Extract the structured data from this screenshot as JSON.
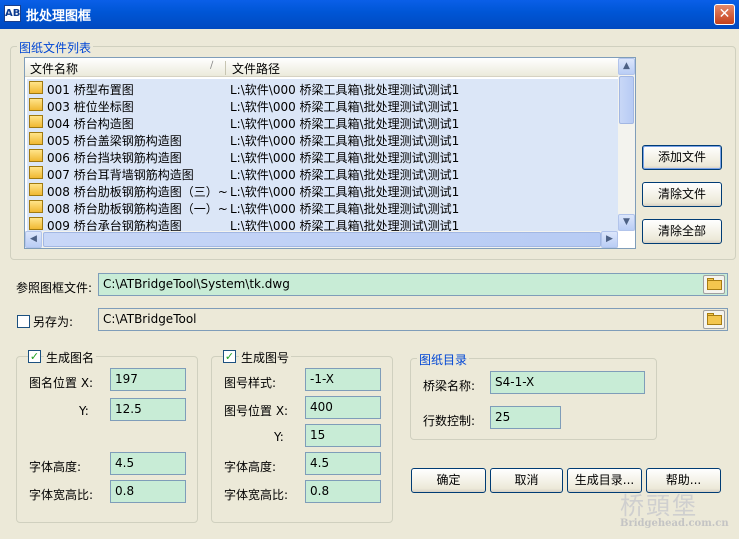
{
  "window": {
    "title": "批处理图框",
    "close_glyph": "✕",
    "icon_text": "AB"
  },
  "file_list": {
    "group_title": "图纸文件列表",
    "columns": {
      "name": "文件名称",
      "sort_glyph": "∕",
      "path": "文件路径"
    },
    "rows": [
      {
        "name": "001 桥型布置图",
        "path": "L:\\软件\\000 桥梁工具箱\\批处理测试\\测试1"
      },
      {
        "name": "003 桩位坐标图",
        "path": "L:\\软件\\000 桥梁工具箱\\批处理测试\\测试1"
      },
      {
        "name": "004 桥台构造图",
        "path": "L:\\软件\\000 桥梁工具箱\\批处理测试\\测试1"
      },
      {
        "name": "005 桥台盖梁钢筋构造图",
        "path": "L:\\软件\\000 桥梁工具箱\\批处理测试\\测试1"
      },
      {
        "name": "006 桥台挡块钢筋构造图",
        "path": "L:\\软件\\000 桥梁工具箱\\批处理测试\\测试1"
      },
      {
        "name": "007 桥台耳背墙钢筋构造图",
        "path": "L:\\软件\\000 桥梁工具箱\\批处理测试\\测试1"
      },
      {
        "name": "008 桥台肋板钢筋构造图（三）~",
        "path": "L:\\软件\\000 桥梁工具箱\\批处理测试\\测试1"
      },
      {
        "name": "008 桥台肋板钢筋构造图（一）~",
        "path": "L:\\软件\\000 桥梁工具箱\\批处理测试\\测试1"
      },
      {
        "name": "009 桥台承台钢筋构造图",
        "path": "L:\\软件\\000 桥梁工具箱\\批处理测试\\测试1"
      }
    ],
    "scroll": {
      "up": "▲",
      "down": "▼",
      "left": "◀",
      "right": "▶"
    }
  },
  "buttons": {
    "add_file": "添加文件",
    "clear_file": "清除文件",
    "clear_all": "清除全部",
    "ok": "确定",
    "cancel": "取消",
    "gen_dir": "生成目录...",
    "help": "帮助..."
  },
  "ref_frame": {
    "label": "参照图框文件:",
    "value": "C:\\ATBridgeTool\\System\\tk.dwg"
  },
  "save_as": {
    "label": "另存为:",
    "checked": false,
    "value": "C:\\ATBridgeTool"
  },
  "gen_name": {
    "title": "生成图名",
    "checked": true,
    "check_glyph": "✓",
    "pos_x_label": "图名位置 X:",
    "pos_x": "197",
    "pos_y_label": "Y:",
    "pos_y": "12.5",
    "font_h_label": "字体高度:",
    "font_h": "4.5",
    "font_ratio_label": "字体宽高比:",
    "font_ratio": "0.8"
  },
  "gen_number": {
    "title": "生成图号",
    "checked": true,
    "check_glyph": "✓",
    "style_label": "图号样式:",
    "style": "-1-X",
    "pos_x_label": "图号位置 X:",
    "pos_x": "400",
    "pos_y_label": "Y:",
    "pos_y": "15",
    "font_h_label": "字体高度:",
    "font_h": "4.5",
    "font_ratio_label": "字体宽高比:",
    "font_ratio": "0.8"
  },
  "catalog": {
    "title": "图纸目录",
    "bridge_label": "桥梁名称:",
    "bridge": "S4-1-X",
    "rows_label": "行数控制:",
    "rows": "25"
  },
  "watermark": {
    "logo": "桥頭堡",
    "url": "Bridgehead.com.cn"
  }
}
